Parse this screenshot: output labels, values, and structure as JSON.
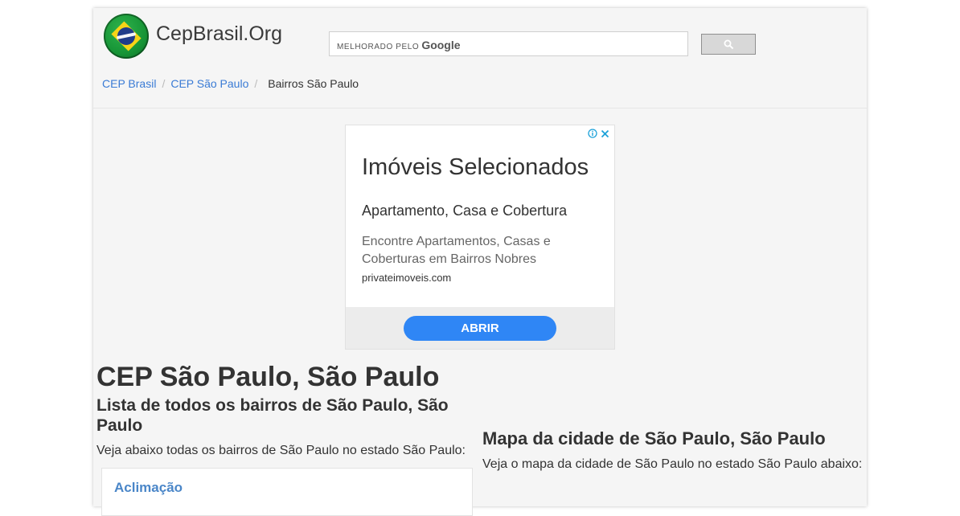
{
  "header": {
    "site_name": "CepBrasil.Org",
    "search": {
      "powered_label": "MELHORADO PELO",
      "google_label": "Google"
    }
  },
  "breadcrumb": {
    "items": [
      "CEP Brasil",
      "CEP São Paulo"
    ],
    "current": "Bairros São Paulo"
  },
  "ad": {
    "title": "Imóveis Selecionados",
    "subtitle": "Apartamento, Casa e Cobertura",
    "description": "Encontre Apartamentos, Casas e Coberturas em Bairros Nobres",
    "url": "privateimoveis.com",
    "button": "ABRIR"
  },
  "main": {
    "title": "CEP São Paulo, São Paulo",
    "subtitle": "Lista de todos os bairros de São Paulo, São Paulo",
    "intro": "Veja abaixo todas os bairros de São Paulo no estado São Paulo:",
    "neighborhoods": [
      "Aclimação"
    ]
  },
  "map": {
    "title": "Mapa da cidade de São Paulo, São Paulo",
    "text": "Veja o mapa da cidade de São Paulo no estado São Paulo abaixo:"
  },
  "colors": {
    "link": "#3a7bd5",
    "ad_button": "#2f86f5",
    "adchoices": "#1ba1d9"
  }
}
